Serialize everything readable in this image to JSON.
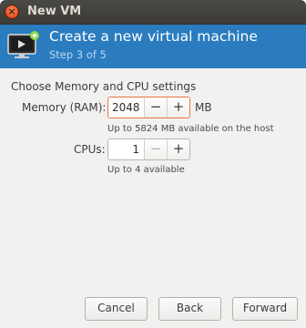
{
  "window": {
    "title": "New VM",
    "close_glyph": "×"
  },
  "header": {
    "title": "Create a new virtual machine",
    "step": "Step 3 of 5",
    "icon": "vm-monitor-icon",
    "accent_color": "#2a7cbf"
  },
  "section": {
    "title": "Choose Memory and CPU settings"
  },
  "memory": {
    "label": "Memory (RAM):",
    "value": "2048",
    "unit": "MB",
    "hint": "Up to 5824 MB available on the host",
    "decrement": "−",
    "increment": "+"
  },
  "cpus": {
    "label": "CPUs:",
    "value": "1",
    "hint": "Up to 4 available",
    "decrement": "−",
    "increment": "+"
  },
  "buttons": {
    "cancel": "Cancel",
    "back": "Back",
    "forward": "Forward"
  }
}
